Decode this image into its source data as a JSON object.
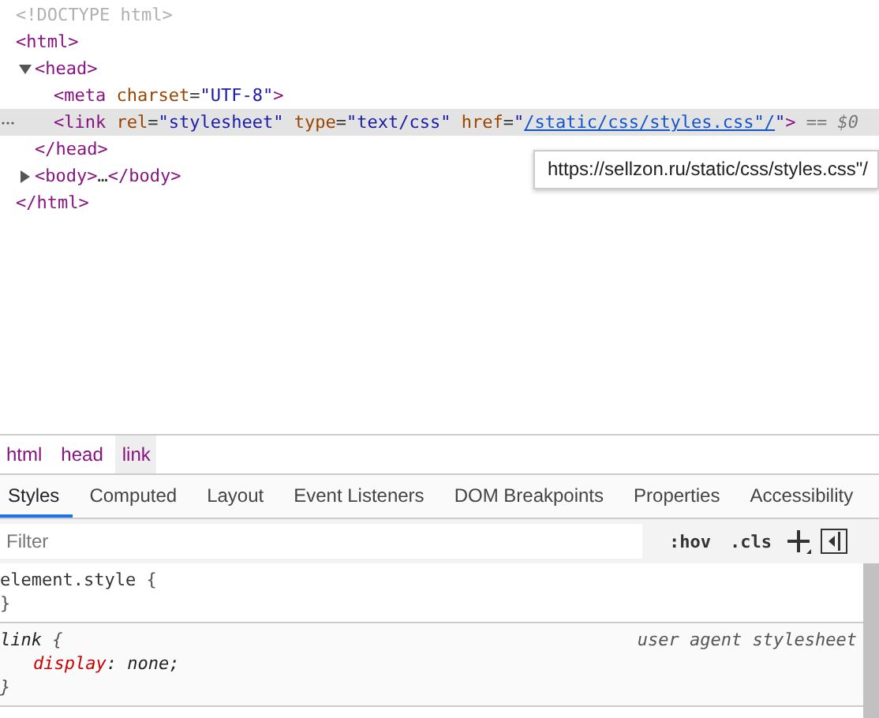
{
  "dom_tree": [
    {
      "open": [
        {
          "kind": "doctype",
          "text": "<!DOCTYPE html>"
        }
      ],
      "selected": false
    },
    {
      "open": [
        {
          "kind": "tag",
          "text": "<html>"
        }
      ],
      "selected": false,
      "close": [
        {
          "kind": "tag",
          "text": "</html>"
        }
      ],
      "children": [
        {
          "open": [
            {
              "kind": "tag",
              "text": "<head>"
            }
          ],
          "expanded": true,
          "selected": false,
          "close": [
            {
              "kind": "tag",
              "text": "</head>"
            }
          ],
          "children": [
            {
              "open": [
                {
                  "kind": "tag",
                  "text": "<meta"
                },
                {
                  "kind": "attr",
                  "text": " charset"
                },
                {
                  "kind": "punct",
                  "text": "="
                },
                {
                  "kind": "value",
                  "text": "\"UTF-8\""
                },
                {
                  "kind": "tag",
                  "text": ">"
                }
              ],
              "selected": false
            },
            {
              "open": [
                {
                  "kind": "tag",
                  "text": "<link"
                },
                {
                  "kind": "attr",
                  "text": " rel"
                },
                {
                  "kind": "punct",
                  "text": "="
                },
                {
                  "kind": "value",
                  "text": "\"stylesheet\""
                },
                {
                  "kind": "attr",
                  "text": " type"
                },
                {
                  "kind": "punct",
                  "text": "="
                },
                {
                  "kind": "value",
                  "text": "\"text/css\""
                },
                {
                  "kind": "attr",
                  "text": " href"
                },
                {
                  "kind": "punct",
                  "text": "="
                },
                {
                  "kind": "value",
                  "text": "\""
                },
                {
                  "kind": "link",
                  "text": "/static/css/styles.css\"/"
                },
                {
                  "kind": "value",
                  "text": "\""
                },
                {
                  "kind": "tag",
                  "text": ">"
                },
                {
                  "kind": "marker",
                  "text": " == $0"
                }
              ],
              "selected": true
            }
          ]
        },
        {
          "open": [
            {
              "kind": "tag",
              "text": "<body>"
            },
            {
              "kind": "ellipsis",
              "text": "…"
            },
            {
              "kind": "tag",
              "text": "</body>"
            }
          ],
          "expanded": false,
          "selected": false
        }
      ]
    }
  ],
  "tooltip": "https://sellzon.ru/static/css/styles.css\"/",
  "breadcrumbs": [
    {
      "label": "html",
      "selected": false
    },
    {
      "label": "head",
      "selected": false
    },
    {
      "label": "link",
      "selected": true
    }
  ],
  "tabs": [
    {
      "label": "Styles",
      "selected": true
    },
    {
      "label": "Computed",
      "selected": false
    },
    {
      "label": "Layout",
      "selected": false
    },
    {
      "label": "Event Listeners",
      "selected": false
    },
    {
      "label": "DOM Breakpoints",
      "selected": false
    },
    {
      "label": "Properties",
      "selected": false
    },
    {
      "label": "Accessibility",
      "selected": false
    }
  ],
  "filter": {
    "placeholder": "Filter",
    "hov": ":hov",
    "cls": ".cls"
  },
  "rules": [
    {
      "kind": "inline",
      "selector": "element.style",
      "open": "{",
      "close": "}"
    },
    {
      "kind": "user_agent",
      "selector": "link",
      "open": "{",
      "close": "}",
      "source": "user agent stylesheet",
      "declarations": [
        {
          "property": "display",
          "separator": ":",
          "value": "none;"
        }
      ]
    }
  ]
}
